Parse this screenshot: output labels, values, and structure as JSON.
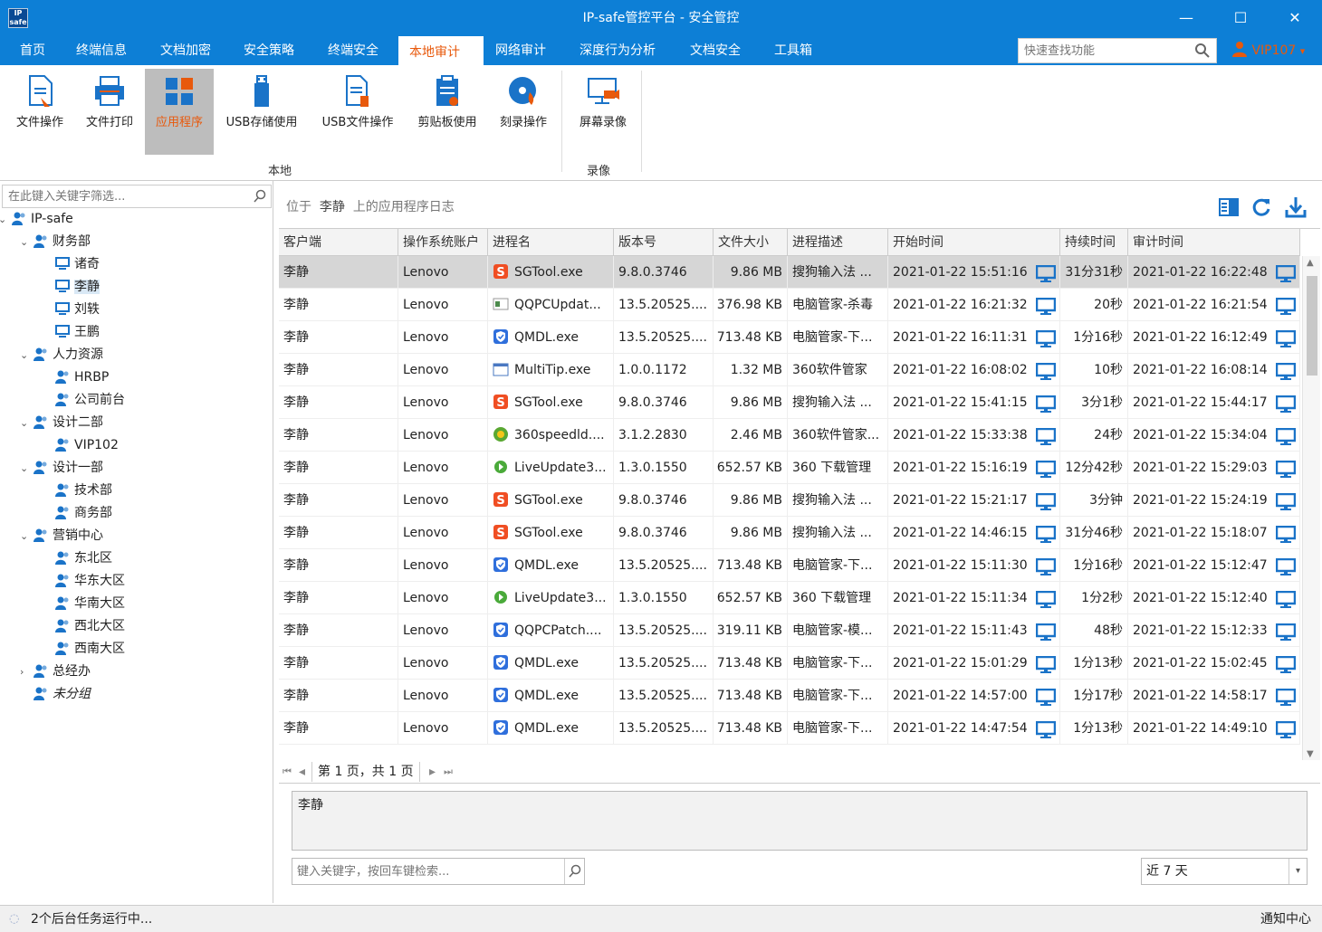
{
  "window": {
    "title": "IP-safe管控平台 - 安全管控",
    "logo": "IP safe",
    "min": "—",
    "max": "☐",
    "close": "✕"
  },
  "menus": [
    "首页",
    "终端信息",
    "文档加密",
    "安全策略",
    "终端安全",
    "本地审计",
    "网络审计",
    "深度行为分析",
    "文档安全",
    "工具箱"
  ],
  "active_menu": "本地审计",
  "quick_search": {
    "placeholder": "快速查找功能"
  },
  "user": {
    "name": "VIP107",
    "arrow": "▾"
  },
  "ribbon": {
    "buttons": [
      "文件操作",
      "文件打印",
      "应用程序",
      "USB存储使用",
      "USB文件操作",
      "剪贴板使用",
      "刻录操作",
      "屏幕录像"
    ],
    "active": "应用程序",
    "groups": {
      "local": "本地",
      "record": "录像"
    }
  },
  "tree": {
    "filter_placeholder": "在此键入关键字筛选...",
    "items": [
      {
        "label": "IP-safe",
        "caret": "v"
      },
      {
        "label": "财务部",
        "caret": "v"
      },
      {
        "label": "诸奇"
      },
      {
        "label": "李静"
      },
      {
        "label": "刘轶"
      },
      {
        "label": "王鹏"
      },
      {
        "label": "人力资源",
        "caret": "v"
      },
      {
        "label": "HRBP"
      },
      {
        "label": "公司前台"
      },
      {
        "label": "设计二部",
        "caret": "v"
      },
      {
        "label": "VIP102"
      },
      {
        "label": "设计一部",
        "caret": "v"
      },
      {
        "label": "技术部"
      },
      {
        "label": "商务部"
      },
      {
        "label": "营销中心",
        "caret": "v"
      },
      {
        "label": "东北区"
      },
      {
        "label": "华东大区"
      },
      {
        "label": "华南大区"
      },
      {
        "label": "西北大区"
      },
      {
        "label": "西南大区"
      },
      {
        "label": "总经办",
        "caret": ">"
      },
      {
        "label": "未分组"
      }
    ]
  },
  "crumb": {
    "prefix": "位于",
    "who": "李静",
    "suffix": "上的应用程序日志"
  },
  "table": {
    "columns": [
      "客户端",
      "操作系统账户",
      "进程名",
      "版本号",
      "文件大小",
      "进程描述",
      "开始时间",
      "持续时间",
      "审计时间"
    ],
    "rows": [
      [
        "李静",
        "Lenovo",
        "SGTool.exe",
        "9.8.0.3746",
        "9.86 MB",
        "搜狗输入法 ...",
        "2021-01-22 15:51:16",
        "31分31秒",
        "2021-01-22 16:22:48"
      ],
      [
        "李静",
        "Lenovo",
        "QQPCUpdat...",
        "13.5.20525....",
        "376.98 KB",
        "电脑管家-杀毒",
        "2021-01-22 16:21:32",
        "20秒",
        "2021-01-22 16:21:54"
      ],
      [
        "李静",
        "Lenovo",
        "QMDL.exe",
        "13.5.20525....",
        "713.48 KB",
        "电脑管家-下...",
        "2021-01-22 16:11:31",
        "1分16秒",
        "2021-01-22 16:12:49"
      ],
      [
        "李静",
        "Lenovo",
        "MultiTip.exe",
        "1.0.0.1172",
        "1.32 MB",
        "360软件管家",
        "2021-01-22 16:08:02",
        "10秒",
        "2021-01-22 16:08:14"
      ],
      [
        "李静",
        "Lenovo",
        "SGTool.exe",
        "9.8.0.3746",
        "9.86 MB",
        "搜狗输入法 ...",
        "2021-01-22 15:41:15",
        "3分1秒",
        "2021-01-22 15:44:17"
      ],
      [
        "李静",
        "Lenovo",
        "360speedld....",
        "3.1.2.2830",
        "2.46 MB",
        "360软件管家...",
        "2021-01-22 15:33:38",
        "24秒",
        "2021-01-22 15:34:04"
      ],
      [
        "李静",
        "Lenovo",
        "LiveUpdate3...",
        "1.3.0.1550",
        "652.57 KB",
        "360 下载管理",
        "2021-01-22 15:16:19",
        "12分42秒",
        "2021-01-22 15:29:03"
      ],
      [
        "李静",
        "Lenovo",
        "SGTool.exe",
        "9.8.0.3746",
        "9.86 MB",
        "搜狗输入法 ...",
        "2021-01-22 15:21:17",
        "3分钟",
        "2021-01-22 15:24:19"
      ],
      [
        "李静",
        "Lenovo",
        "SGTool.exe",
        "9.8.0.3746",
        "9.86 MB",
        "搜狗输入法 ...",
        "2021-01-22 14:46:15",
        "31分46秒",
        "2021-01-22 15:18:07"
      ],
      [
        "李静",
        "Lenovo",
        "QMDL.exe",
        "13.5.20525....",
        "713.48 KB",
        "电脑管家-下...",
        "2021-01-22 15:11:30",
        "1分16秒",
        "2021-01-22 15:12:47"
      ],
      [
        "李静",
        "Lenovo",
        "LiveUpdate3...",
        "1.3.0.1550",
        "652.57 KB",
        "360 下载管理",
        "2021-01-22 15:11:34",
        "1分2秒",
        "2021-01-22 15:12:40"
      ],
      [
        "李静",
        "Lenovo",
        "QQPCPatch....",
        "13.5.20525....",
        "319.11 KB",
        "电脑管家-模...",
        "2021-01-22 15:11:43",
        "48秒",
        "2021-01-22 15:12:33"
      ],
      [
        "李静",
        "Lenovo",
        "QMDL.exe",
        "13.5.20525....",
        "713.48 KB",
        "电脑管家-下...",
        "2021-01-22 15:01:29",
        "1分13秒",
        "2021-01-22 15:02:45"
      ],
      [
        "李静",
        "Lenovo",
        "QMDL.exe",
        "13.5.20525....",
        "713.48 KB",
        "电脑管家-下...",
        "2021-01-22 14:57:00",
        "1分17秒",
        "2021-01-22 14:58:17"
      ],
      [
        "李静",
        "Lenovo",
        "QMDL.exe",
        "13.5.20525....",
        "713.48 KB",
        "电脑管家-下...",
        "2021-01-22 14:47:54",
        "1分13秒",
        "2021-01-22 14:49:10"
      ]
    ],
    "row_icons": [
      "sogou",
      "qqpc",
      "qmdl",
      "multitip",
      "sogou",
      "s360speed",
      "liveupdate",
      "sogou",
      "sogou",
      "qmdl",
      "liveupdate",
      "qmdl",
      "qmdl",
      "qmdl",
      "qmdl"
    ],
    "selected_row": 0
  },
  "pager": {
    "text": "第 1 页，共 1 页",
    "first": "⏮",
    "prev": "◂",
    "next": "▸",
    "last": "⏭"
  },
  "detail": {
    "text": "李静"
  },
  "keyword_search": {
    "placeholder": "键入关键字，按回车键检索..."
  },
  "range": {
    "value": "近 7 天",
    "arrow": "▾"
  },
  "status": {
    "tasks": "2个后台任务运行中...",
    "notify": "通知中心"
  },
  "colors": {
    "brand": "#0d7fd6",
    "accent": "#e8590c",
    "monitor": "#1a73c8"
  }
}
